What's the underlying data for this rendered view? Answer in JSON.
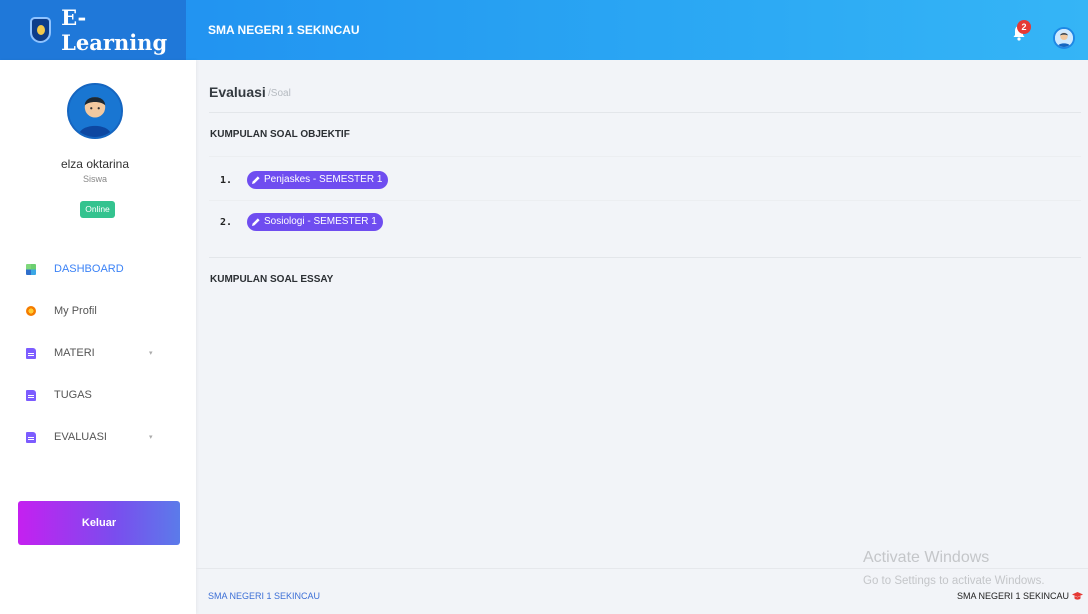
{
  "topbar": {
    "brand": "E-Learning",
    "school_name": "SMA NEGERI 1 SEKINCAU",
    "notification_count": "2",
    "colors": {
      "bar": "#2aa6f3",
      "brand_bg": "#1f78d9",
      "badge": "#e53935"
    }
  },
  "sidebar": {
    "user_name": "elza oktarina",
    "user_role": "Siswa",
    "status": "Online",
    "items": [
      {
        "label": "DASHBOARD",
        "icon": "dashboard-icon",
        "active": true
      },
      {
        "label": "My Profil",
        "icon": "profile-icon"
      },
      {
        "label": "MATERI",
        "icon": "document-icon",
        "caret": "▾"
      },
      {
        "label": "TUGAS",
        "icon": "document-icon"
      },
      {
        "label": "EVALUASI",
        "icon": "document-icon",
        "caret": "▾"
      }
    ],
    "logout_label": "Keluar"
  },
  "main": {
    "title": "Evaluasi",
    "crumb": "/Soal",
    "objective_title": "KUMPULAN SOAL OBJEKTIF",
    "objective_items": [
      {
        "num": "1.",
        "label": "Penjaskes - SEMESTER 1"
      },
      {
        "num": "2.",
        "label": "Sosiologi - SEMESTER 1"
      }
    ],
    "essay_title": "KUMPULAN SOAL ESSAY"
  },
  "footer": {
    "left": "SMA NEGERI 1 SEKINCAU",
    "right": "SMA NEGERI 1 SEKINCAU"
  },
  "watermark": {
    "line1": "Activate Windows",
    "line2": "Go to Settings to activate Windows."
  }
}
